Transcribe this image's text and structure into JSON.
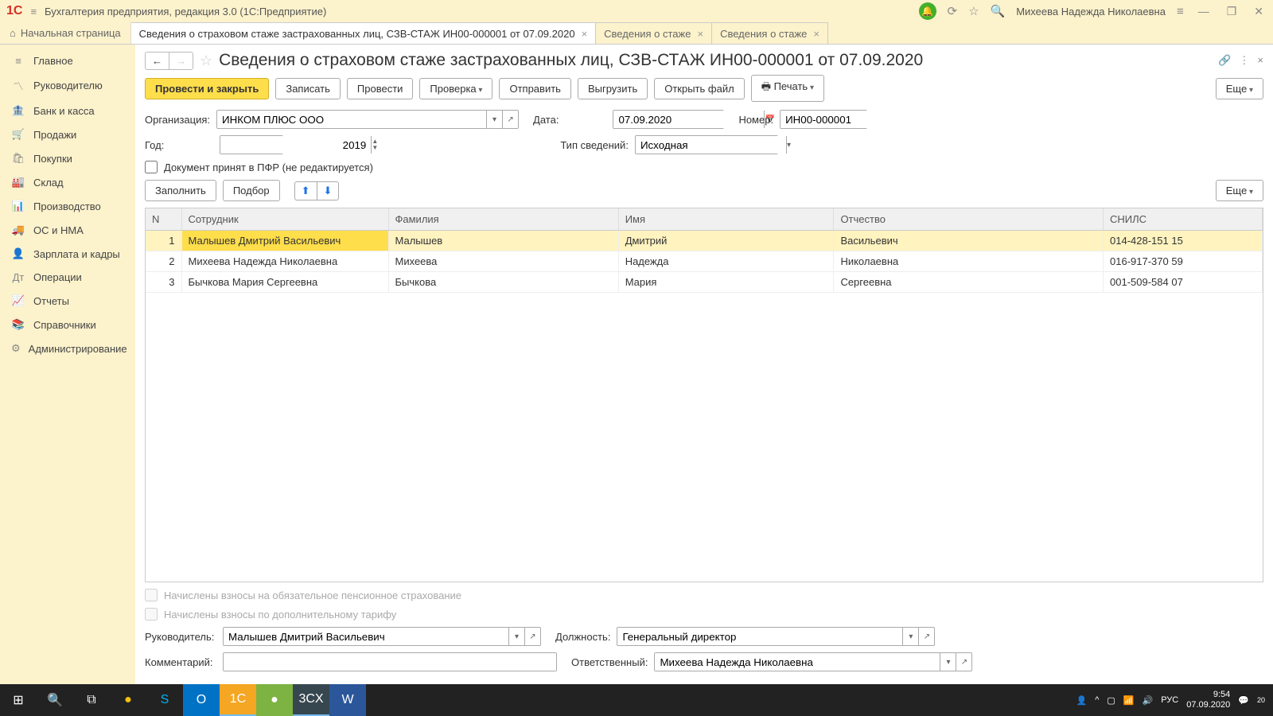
{
  "titlebar": {
    "logo": "1C",
    "app_title": "Бухгалтерия предприятия, редакция 3.0  (1С:Предприятие)",
    "user": "Михеева Надежда Николаевна"
  },
  "tabs": {
    "home": "Начальная страница",
    "active": "Сведения о страховом стаже застрахованных лиц, СЗВ-СТАЖ ИН00-000001 от 07.09.2020",
    "inactive1": "Сведения о стаже",
    "inactive2": "Сведения о стаже"
  },
  "sidebar": [
    {
      "icon": "≡",
      "label": "Главное"
    },
    {
      "icon": "〽",
      "label": "Руководителю"
    },
    {
      "icon": "🏦",
      "label": "Банк и касса"
    },
    {
      "icon": "🛒",
      "label": "Продажи"
    },
    {
      "icon": "🛍",
      "label": "Покупки"
    },
    {
      "icon": "🏭",
      "label": "Склад"
    },
    {
      "icon": "📊",
      "label": "Производство"
    },
    {
      "icon": "🚚",
      "label": "ОС и НМА"
    },
    {
      "icon": "👤",
      "label": "Зарплата и кадры"
    },
    {
      "icon": "Дт",
      "label": "Операции"
    },
    {
      "icon": "📈",
      "label": "Отчеты"
    },
    {
      "icon": "📚",
      "label": "Справочники"
    },
    {
      "icon": "⚙",
      "label": "Администрирование"
    }
  ],
  "page_title": "Сведения о страховом стаже застрахованных лиц, СЗВ-СТАЖ ИН00-000001 от 07.09.2020",
  "toolbar": {
    "post_close": "Провести и закрыть",
    "write": "Записать",
    "post": "Провести",
    "check": "Проверка",
    "send": "Отправить",
    "export": "Выгрузить",
    "open_file": "Открыть файл",
    "print": "Печать",
    "more": "Еще"
  },
  "form": {
    "org_label": "Организация:",
    "org_value": "ИНКОМ ПЛЮС ООО",
    "date_label": "Дата:",
    "date_value": "07.09.2020",
    "number_label": "Номер:",
    "number_value": "ИН00-000001",
    "year_label": "Год:",
    "year_value": "2019",
    "type_label": "Тип сведений:",
    "type_value": "Исходная",
    "pfr_accepted": "Документ принят в ПФР (не редактируется)",
    "fill": "Заполнить",
    "select": "Подбор"
  },
  "table": {
    "headers": {
      "n": "N",
      "employee": "Сотрудник",
      "surname": "Фамилия",
      "name": "Имя",
      "patronymic": "Отчество",
      "snils": "СНИЛС"
    },
    "rows": [
      {
        "n": "1",
        "employee": "Малышев Дмитрий Васильевич",
        "surname": "Малышев",
        "name": "Дмитрий",
        "patronymic": "Васильевич",
        "snils": "014-428-151 15"
      },
      {
        "n": "2",
        "employee": "Михеева Надежда Николаевна",
        "surname": "Михеева",
        "name": "Надежда",
        "patronymic": "Николаевна",
        "snils": "016-917-370 59"
      },
      {
        "n": "3",
        "employee": "Бычкова Мария Сергеевна",
        "surname": "Бычкова",
        "name": "Мария",
        "patronymic": "Сергеевна",
        "snils": "001-509-584 07"
      }
    ]
  },
  "bottom": {
    "chk1": "Начислены взносы на обязательное пенсионное страхование",
    "chk2": "Начислены взносы по дополнительному тарифу",
    "head_label": "Руководитель:",
    "head_value": "Малышев Дмитрий Васильевич",
    "position_label": "Должность:",
    "position_value": "Генеральный директор",
    "comment_label": "Комментарий:",
    "responsible_label": "Ответственный:",
    "responsible_value": "Михеева Надежда Николаевна"
  },
  "taskbar": {
    "lang": "РУС",
    "time": "9:54",
    "date": "07.09.2020",
    "count": "20"
  }
}
